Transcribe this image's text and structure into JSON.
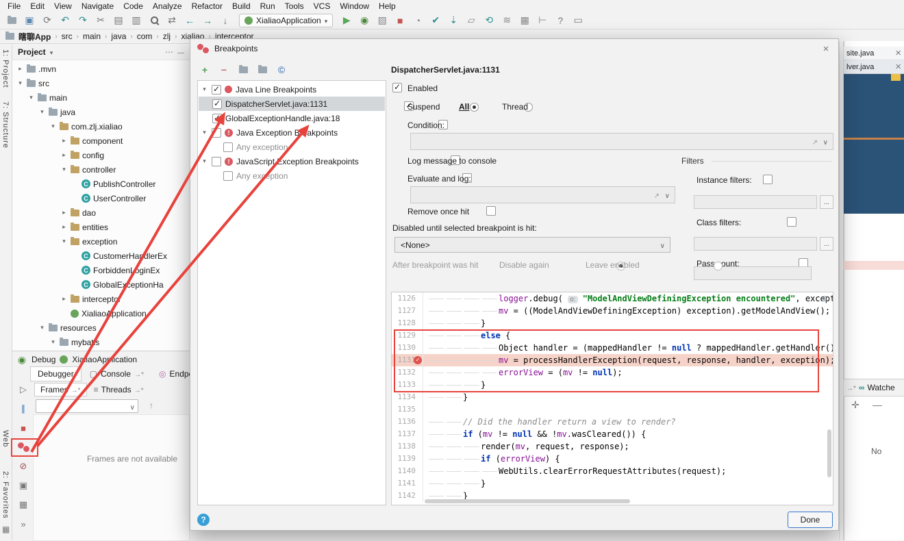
{
  "colors": {
    "annotation_red": "#e8423c",
    "breakpoint_red": "#db5860",
    "selection_dark_blue": "#2b5277",
    "breakpoint_line_highlight": "#f6d3c9"
  },
  "menu_bar": {
    "items": [
      "File",
      "Edit",
      "View",
      "Navigate",
      "Code",
      "Analyze",
      "Refactor",
      "Build",
      "Run",
      "Tools",
      "VCS",
      "Window",
      "Help"
    ]
  },
  "toolbar": {
    "icons_left": [
      "open-icon",
      "save-icon",
      "sync-icon",
      "undo-icon",
      "redo-icon",
      "cut-icon",
      "copy-icon",
      "paste-icon",
      "search-icon",
      "replace-icon",
      "back-icon",
      "forward-icon",
      "step-down-icon"
    ],
    "icons_right": [
      "run-icon",
      "debug-bug-icon",
      "coverage-icon",
      "stop-icon",
      "profiler-icon",
      "commit-check-icon",
      "update-icon",
      "diff-icon",
      "rollback-icon",
      "stash-icon",
      "table-icon",
      "ruler-icon",
      "help-icon",
      "terminal-icon"
    ],
    "run_config": "XialiaoApplication"
  },
  "breadcrumb": {
    "separator": "›",
    "items": [
      "瞎聊App",
      "src",
      "main",
      "java",
      "com",
      "zlj",
      "xialiao",
      "interceptor"
    ]
  },
  "left_toolbar": {
    "top": [
      "1: Project",
      "7: Structure"
    ],
    "bottom": [
      "Web",
      "2: Favorites"
    ]
  },
  "project": {
    "title": "Project",
    "tree": [
      {
        "label": ".mvn",
        "level": 1,
        "arrow": ">",
        "icon": "folder"
      },
      {
        "label": "src",
        "level": 1,
        "arrow": "v",
        "icon": "folder"
      },
      {
        "label": "main",
        "level": 2,
        "arrow": "v",
        "icon": "folder"
      },
      {
        "label": "java",
        "level": 3,
        "arrow": "v",
        "icon": "folder"
      },
      {
        "label": "com.zlj.xialiao",
        "level": 4,
        "arrow": "v",
        "icon": "package"
      },
      {
        "label": "component",
        "level": 5,
        "arrow": ">",
        "icon": "package"
      },
      {
        "label": "config",
        "level": 5,
        "arrow": ">",
        "icon": "package"
      },
      {
        "label": "controller",
        "level": 5,
        "arrow": "v",
        "icon": "package"
      },
      {
        "label": "PublishController",
        "level": 6,
        "arrow": "",
        "icon": "class"
      },
      {
        "label": "UserController",
        "level": 6,
        "arrow": "",
        "icon": "class"
      },
      {
        "label": "dao",
        "level": 5,
        "arrow": ">",
        "icon": "package"
      },
      {
        "label": "entities",
        "level": 5,
        "arrow": ">",
        "icon": "package"
      },
      {
        "label": "exception",
        "level": 5,
        "arrow": "v",
        "icon": "package"
      },
      {
        "label": "CustomerHandlerEx",
        "level": 6,
        "arrow": "",
        "icon": "class"
      },
      {
        "label": "ForbiddenLoginEx",
        "level": 6,
        "arrow": "",
        "icon": "class"
      },
      {
        "label": "GlobalExceptionHa",
        "level": 6,
        "arrow": "",
        "icon": "class"
      },
      {
        "label": "interceptor",
        "level": 5,
        "arrow": ">",
        "icon": "package"
      },
      {
        "label": "XialiaoApplication",
        "level": 5,
        "arrow": "",
        "icon": "leaf"
      },
      {
        "label": "resources",
        "level": 3,
        "arrow": "v",
        "icon": "folder"
      },
      {
        "label": "mybatis",
        "level": 4,
        "arrow": "v",
        "icon": "folder"
      }
    ]
  },
  "debug": {
    "label": "Debug",
    "config": "XialiaoApplication",
    "tabs": [
      {
        "label": "Debugger"
      },
      {
        "label": "Console"
      },
      {
        "label": "Endpoints"
      }
    ],
    "subtabs": [
      {
        "label": "Frames"
      },
      {
        "label": "Threads"
      }
    ],
    "message": "Frames are not available",
    "side_icons": [
      "resume-icon",
      "pause-icon",
      "debug-stop-icon",
      "view-breakpoints-icon",
      "mute-breakpoints-icon",
      "screenshot-icon",
      "layout-icon",
      "more-icon"
    ]
  },
  "dialog": {
    "title": "Breakpoints",
    "toolbar_icons": [
      "add-breakpoint-icon",
      "remove-breakpoint-icon",
      "group-by-file-icon",
      "group-by-class-icon",
      "group-by-package-icon"
    ],
    "tree": [
      {
        "label": "Java Line Breakpoints",
        "checked": true,
        "arrow": "v",
        "icon": "line-bp"
      },
      {
        "label": "DispatcherServlet.java:1131",
        "checked": true,
        "selected": true,
        "indent": 1
      },
      {
        "label": "GlobalExceptionHandle.java:18",
        "checked": true,
        "indent": 1
      },
      {
        "label": "Java Exception Breakpoints",
        "checked": false,
        "arrow": "v",
        "icon": "ex-bp"
      },
      {
        "label": "Any exception",
        "checked": false,
        "indent": 2,
        "muted": true
      },
      {
        "label": "JavaScript Exception Breakpoints",
        "checked": false,
        "arrow": "v",
        "icon": "ex-bp"
      },
      {
        "label": "Any exception",
        "checked": false,
        "indent": 2,
        "muted": true
      }
    ],
    "detail": {
      "header": "DispatcherServlet.java:1131",
      "enabled_label": "Enabled",
      "suspend_label": "Suspend",
      "suspend_all": "All",
      "suspend_thread": "Thread",
      "condition_label": "Condition:",
      "log_label": "Log message to console",
      "evaluate_label": "Evaluate and log:",
      "remove_label": "Remove once hit",
      "disabled_until_label": "Disabled until selected breakpoint is hit:",
      "disabled_until_value": "<None>",
      "after_hit_label": "After breakpoint was hit",
      "after_hit_disable": "Disable again",
      "after_hit_leave": "Leave enabled",
      "filters_label": "Filters",
      "instance_label": "Instance filters:",
      "class_label": "Class filters:",
      "pass_label": "Pass count:",
      "ellipsis": "...",
      "states": {
        "enabled": true,
        "suspend": true,
        "suspend_all": true,
        "suspend_thread": false,
        "condition": false,
        "log_console": false,
        "evaluate": false,
        "remove_once": false,
        "instance": false,
        "class": false,
        "pass": false,
        "after_disable": true,
        "after_leave": false
      }
    },
    "code": {
      "breakpoint_line": 1131,
      "lines": [
        {
          "num": 1126,
          "indent": 4,
          "text": "logger.debug( o: \"ModelAndViewDefiningException encountered\", exception);"
        },
        {
          "num": 1127,
          "indent": 4,
          "text": "mv = ((ModelAndViewDefiningException) exception).getModelAndView();"
        },
        {
          "num": 1128,
          "indent": 3,
          "text": "}"
        },
        {
          "num": 1129,
          "indent": 3,
          "text": "else {"
        },
        {
          "num": 1130,
          "indent": 4,
          "text": "Object handler = (mappedHandler != null ? mappedHandler.getHandler() : null);"
        },
        {
          "num": 1131,
          "indent": 4,
          "text": "mv = processHandlerException(request, response, handler, exception);"
        },
        {
          "num": 1132,
          "indent": 4,
          "text": "errorView = (mv != null);"
        },
        {
          "num": 1133,
          "indent": 3,
          "text": "}"
        },
        {
          "num": 1134,
          "indent": 2,
          "text": "}"
        },
        {
          "num": 1135,
          "indent": 0,
          "text": ""
        },
        {
          "num": 1136,
          "indent": 2,
          "text": "// Did the handler return a view to render?"
        },
        {
          "num": 1137,
          "indent": 2,
          "text": "if (mv != null && !mv.wasCleared()) {"
        },
        {
          "num": 1138,
          "indent": 3,
          "text": "render(mv, request, response);"
        },
        {
          "num": 1139,
          "indent": 3,
          "text": "if (errorView) {"
        },
        {
          "num": 1140,
          "indent": 4,
          "text": "WebUtils.clearErrorRequestAttributes(request);"
        },
        {
          "num": 1141,
          "indent": 3,
          "text": "}"
        },
        {
          "num": 1142,
          "indent": 2,
          "text": "}"
        }
      ]
    },
    "done_label": "Done"
  },
  "right_panel": {
    "tabs": [
      {
        "label": "site.java"
      },
      {
        "label": "lver.java"
      }
    ],
    "watches": {
      "title": "Watche",
      "toolbar": [
        "add-watch-icon",
        "remove-watch-icon"
      ],
      "empty_text": "No"
    }
  }
}
